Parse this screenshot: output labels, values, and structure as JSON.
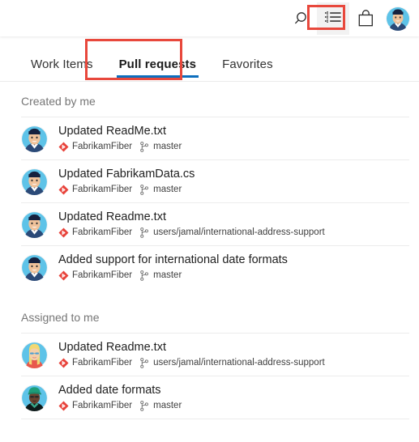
{
  "header": {
    "icons": [
      {
        "name": "search-icon",
        "label": "Search"
      },
      {
        "name": "feed-list-icon",
        "label": "My work"
      },
      {
        "name": "marketplace-bag-icon",
        "label": "Marketplace"
      },
      {
        "name": "user-avatar-icon",
        "label": "User profile"
      }
    ],
    "highlight_color": "#e8483c",
    "highlighted_icon": "feed-list-icon"
  },
  "tabs": [
    {
      "label": "Work Items",
      "selected": false
    },
    {
      "label": "Pull requests",
      "selected": true
    },
    {
      "label": "Favorites",
      "selected": false
    }
  ],
  "tab_accent_color": "#0c6ebd",
  "groups": [
    {
      "title": "Created by me",
      "items": [
        {
          "title": "Updated ReadMe.txt",
          "repo": "FabrikamFiber",
          "branch": "master",
          "avatar": "man-dark-hair"
        },
        {
          "title": "Updated FabrikamData.cs",
          "repo": "FabrikamFiber",
          "branch": "master",
          "avatar": "man-dark-hair"
        },
        {
          "title": "Updated Readme.txt",
          "repo": "FabrikamFiber",
          "branch": "users/jamal/international-address-support",
          "avatar": "man-dark-hair"
        },
        {
          "title": "Added support for international date formats",
          "repo": "FabrikamFiber",
          "branch": "master",
          "avatar": "man-dark-hair"
        }
      ]
    },
    {
      "title": "Assigned to me",
      "items": [
        {
          "title": "Updated Readme.txt",
          "repo": "FabrikamFiber",
          "branch": "users/jamal/international-address-support",
          "avatar": "woman-blonde"
        },
        {
          "title": "Added date formats",
          "repo": "FabrikamFiber",
          "branch": "master",
          "avatar": "man-green-cap"
        }
      ]
    }
  ],
  "colors": {
    "repo_icon": "#e8433b",
    "branch_icon": "#6e6e6e",
    "group_title": "#767676",
    "divider": "#ececec"
  }
}
